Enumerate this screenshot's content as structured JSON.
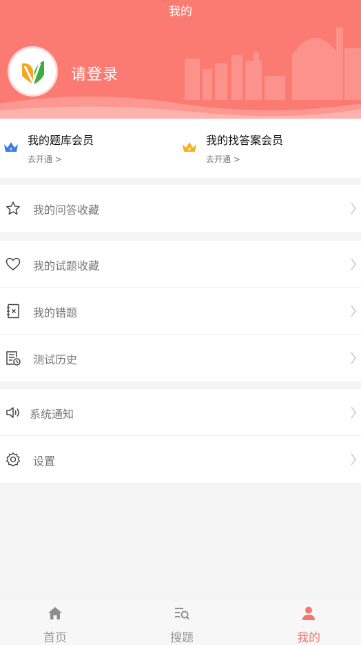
{
  "header": {
    "title": "我的",
    "login_text": "请登录",
    "colors": {
      "background": "#fb7b73",
      "accent": "#f2776f"
    }
  },
  "members": [
    {
      "title": "我的题库会员",
      "subtitle": "去开通 >",
      "icon": "crown-blue-icon"
    },
    {
      "title": "我的找答案会员",
      "subtitle": "去开通 >",
      "icon": "crown-gold-icon"
    }
  ],
  "menu": {
    "qa_favorites": {
      "label": "我的问答收藏",
      "icon": "star-icon"
    },
    "question_favorites": {
      "label": "我的试题收藏",
      "icon": "heart-icon"
    },
    "wrong_questions": {
      "label": "我的错题",
      "icon": "notebook-icon"
    },
    "test_history": {
      "label": "测试历史",
      "icon": "history-doc-icon"
    },
    "notifications": {
      "label": "系统通知",
      "icon": "speaker-icon"
    },
    "settings": {
      "label": "设置",
      "icon": "gear-icon"
    }
  },
  "tabbar": {
    "home": {
      "label": "首页",
      "icon": "home-icon"
    },
    "search": {
      "label": "搜题",
      "icon": "search-list-icon"
    },
    "mine": {
      "label": "我的",
      "icon": "person-icon",
      "active": true
    }
  }
}
